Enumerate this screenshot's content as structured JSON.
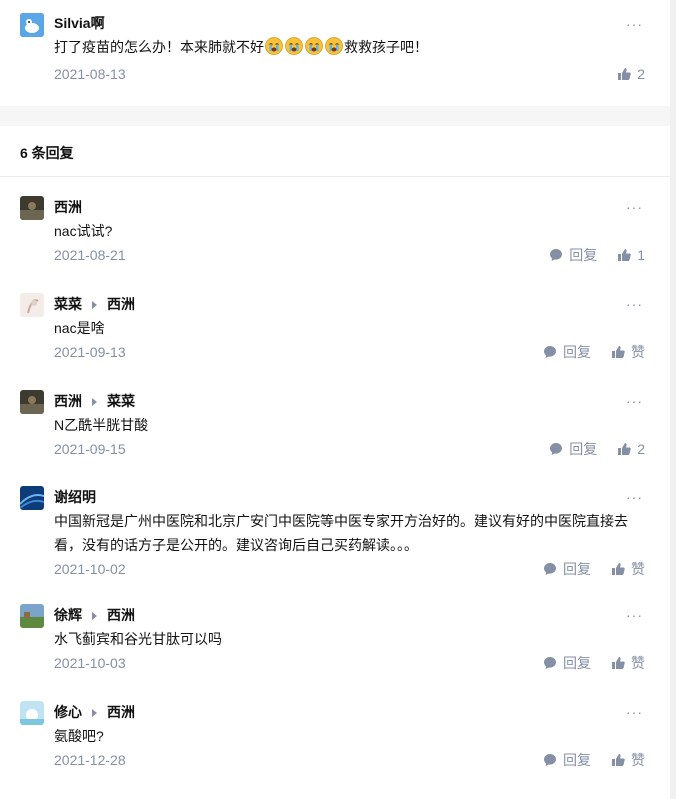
{
  "top_comment": {
    "author": "Silvia啊",
    "text_before": "打了疫苗的怎么办！本来肺就不好",
    "emoji_name": "crying-face-emoji",
    "emoji_count": 4,
    "text_after": "救救孩子吧！",
    "date": "2021-08-13",
    "likes": "2"
  },
  "replies_header": "6 条回复",
  "reply_label": "回复",
  "like_label": "赞",
  "more_glyph": "···",
  "replies": [
    {
      "author": "西洲",
      "reply_to": "",
      "text": "nac试试?",
      "date": "2021-08-21",
      "likes": "1"
    },
    {
      "author": "菜菜",
      "reply_to": "西洲",
      "text": "nac是啥",
      "date": "2021-09-13",
      "likes": "赞"
    },
    {
      "author": "西洲",
      "reply_to": "菜菜",
      "text": "N乙酰半胱甘酸",
      "date": "2021-09-15",
      "likes": "2"
    },
    {
      "author": "谢绍明",
      "reply_to": "",
      "text": "中国新冠是广州中医院和北京广安门中医院等中医专家开方治好的。建议有好的中医院直接去看，没有的话方子是公开的。建议咨询后自己买药解读。。。",
      "date": "2021-10-02",
      "likes": "赞"
    },
    {
      "author": "徐辉",
      "reply_to": "西洲",
      "text": "水飞蓟宾和谷光甘肽可以吗",
      "date": "2021-10-03",
      "likes": "赞"
    },
    {
      "author": "修心",
      "reply_to": "西洲",
      "text": "氨酸吧?",
      "date": "2021-12-28",
      "likes": "赞"
    }
  ],
  "colors": {
    "meta": "#8590a6",
    "text": "#121212",
    "divider": "#ebebeb",
    "gap": "#f6f6f6"
  }
}
